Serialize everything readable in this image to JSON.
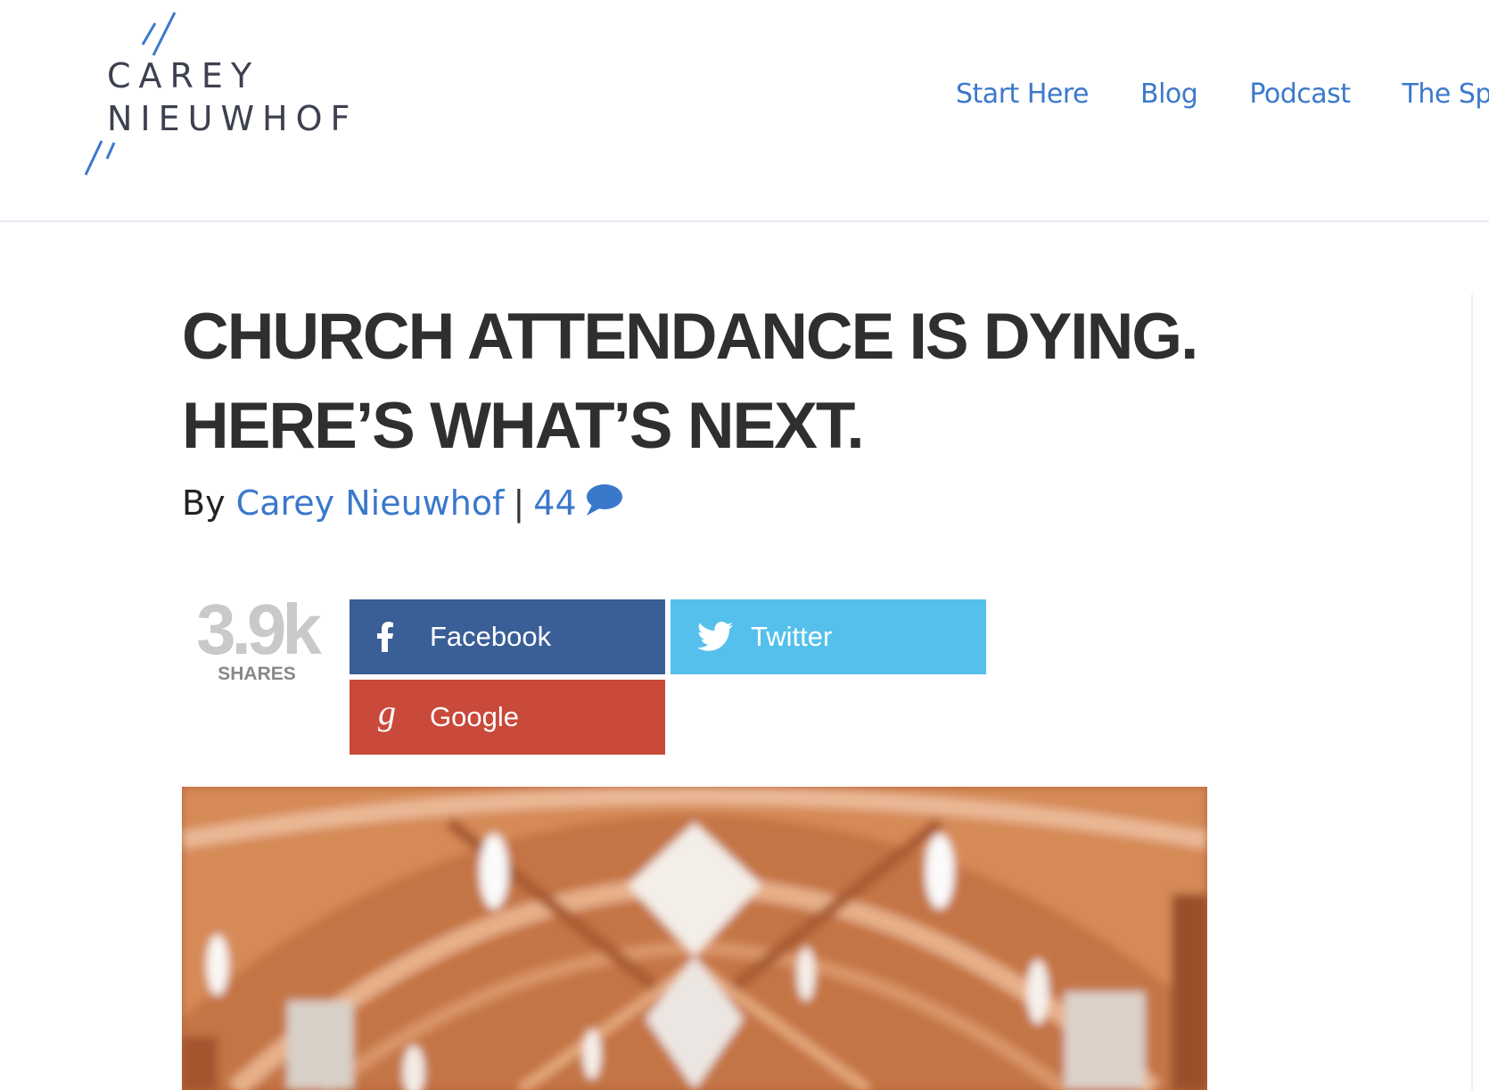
{
  "brand": {
    "line1": "CAREY",
    "line2": "NIEUWHOF"
  },
  "nav": {
    "items": [
      "Start Here",
      "Blog",
      "Podcast",
      "The Speak"
    ]
  },
  "post": {
    "title": "CHURCH ATTENDANCE IS DYING. HERE’S WHAT’S NEXT.",
    "by": "By",
    "author": "Carey Nieuwhof",
    "separator": "|",
    "comment_count": "44"
  },
  "share": {
    "count": "3.9k",
    "label": "SHARES",
    "buttons": {
      "facebook": "Facebook",
      "twitter": "Twitter",
      "google": "Google"
    }
  },
  "colors": {
    "brand_blue": "#3b79cc",
    "facebook": "#3a5e96",
    "twitter": "#55c0ec",
    "google": "#c9493a",
    "title": "#2f2f2f"
  },
  "icons": [
    "logo-slash-marks",
    "comment-bubble-icon",
    "facebook-icon",
    "twitter-icon",
    "google-icon"
  ]
}
